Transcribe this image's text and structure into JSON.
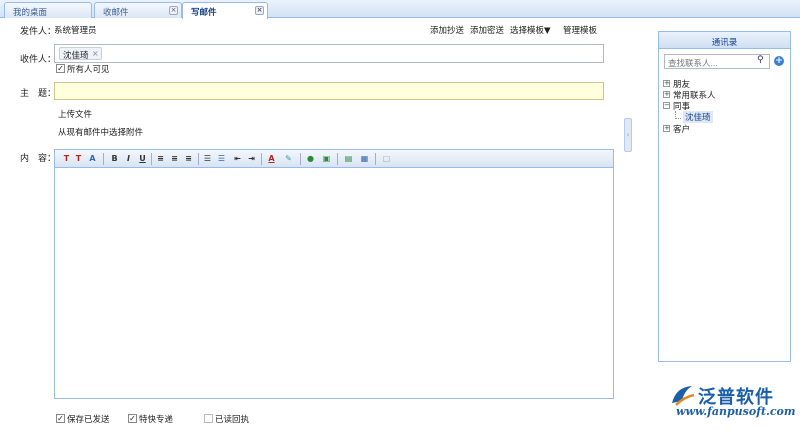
{
  "tabs": [
    {
      "label": "我的桌面",
      "active": false
    },
    {
      "label": "收邮件",
      "active": false
    },
    {
      "label": "写邮件",
      "active": true
    }
  ],
  "form": {
    "sender_label": "发件人：",
    "sender_value": "系统管理员",
    "links": [
      "添加抄送",
      "添加密送",
      "选择模板▼",
      "管理模板"
    ],
    "recipient_label": "收件人：",
    "recipients": [
      "沈佳琦"
    ],
    "visible_to_all_label": "所有人可见",
    "visible_to_all_checked": true,
    "subject_label": "主　题：",
    "subject_value": "",
    "upload_label": "上传文件",
    "existing_attachment_label": "从现有邮件中选择附件",
    "content_label": "内　容：",
    "content_value": ""
  },
  "editor_toolbar": [
    "font-family-icon",
    "font-size-icon",
    "format-icon",
    "bold-icon",
    "italic-icon",
    "underline-icon",
    "align-left-icon",
    "align-center-icon",
    "align-right-icon",
    "ordered-list-icon",
    "unordered-list-icon",
    "outdent-icon",
    "indent-icon",
    "font-color-icon",
    "highlight-icon",
    "link-icon",
    "image-icon",
    "table-icon",
    "insert-icon",
    "source-icon"
  ],
  "options": [
    {
      "label": "保存已发送",
      "checked": true
    },
    {
      "label": "特快专递",
      "checked": true
    },
    {
      "label": "已读回执",
      "checked": false
    }
  ],
  "contacts": {
    "title": "通讯录",
    "search_placeholder": "查找联系人...",
    "groups": [
      {
        "label": "朋友",
        "expanded": false
      },
      {
        "label": "常用联系人",
        "expanded": false
      },
      {
        "label": "同事",
        "expanded": true,
        "children": [
          "沈佳琦"
        ]
      },
      {
        "label": "客户",
        "expanded": false
      }
    ]
  },
  "logo": {
    "name": "泛普软件",
    "url": "www.fanpusoft.com"
  },
  "colors": {
    "accent": "#15428b",
    "border": "#99bbe8",
    "subject_bg": "#ffffde"
  }
}
